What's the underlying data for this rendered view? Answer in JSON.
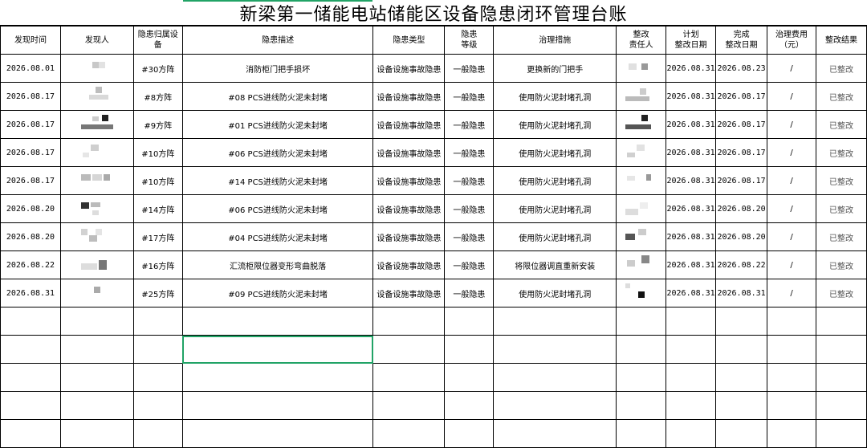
{
  "title": "新梁第一储能电站储能区设备隐患闭环管理台账",
  "columns": [
    "发现时间",
    "发现人",
    "隐患归属设备",
    "隐患描述",
    "隐患类型",
    "隐患等级",
    "治理措施",
    "整改责任人",
    "计划整改日期",
    "完成整改日期",
    "治理费用（元）",
    "整改结果"
  ],
  "header_text": {
    "c0": "发现时间",
    "c1": "发现人",
    "c2": "隐患归属设\n备",
    "c3": "隐患描述",
    "c4": "隐患类型",
    "c5": "隐患\n等级",
    "c6": "治理措施",
    "c7": "整改\n责任人",
    "c8": "计划\n整改日期",
    "c9": "完成\n整改日期",
    "c10": "治理费用\n（元）",
    "c11": "整改结果"
  },
  "rows": [
    {
      "date": "2026.08.01",
      "equipment": "#30方阵",
      "description": "消防柜门把手损坏",
      "type": "设备设施事故隐患",
      "level": "一般隐患",
      "measure": "更换新的门把手",
      "planned": "2026.08.31",
      "completed": "2026.08.23",
      "cost": "/",
      "result": "已整改"
    },
    {
      "date": "2026.08.17",
      "equipment": "#8方阵",
      "description": "#08 PCS进线防火泥未封堵",
      "type": "设备设施事故隐患",
      "level": "一般隐患",
      "measure": "使用防火泥封堵孔洞",
      "planned": "2026.08.31",
      "completed": "2026.08.17",
      "cost": "/",
      "result": "已整改"
    },
    {
      "date": "2026.08.17",
      "equipment": "#9方阵",
      "description": "#01 PCS进线防火泥未封堵",
      "type": "设备设施事故隐患",
      "level": "一般隐患",
      "measure": "使用防火泥封堵孔洞",
      "planned": "2026.08.31",
      "completed": "2026.08.17",
      "cost": "/",
      "result": "已整改"
    },
    {
      "date": "2026.08.17",
      "equipment": "#10方阵",
      "description": "#06 PCS进线防火泥未封堵",
      "type": "设备设施事故隐患",
      "level": "一般隐患",
      "measure": "使用防火泥封堵孔洞",
      "planned": "2026.08.31",
      "completed": "2026.08.17",
      "cost": "/",
      "result": "已整改"
    },
    {
      "date": "2026.08.17",
      "equipment": "#10方阵",
      "description": "#14 PCS进线防火泥未封堵",
      "type": "设备设施事故隐患",
      "level": "一般隐患",
      "measure": "使用防火泥封堵孔洞",
      "planned": "2026.08.31",
      "completed": "2026.08.17",
      "cost": "/",
      "result": "已整改"
    },
    {
      "date": "2026.08.20",
      "equipment": "#14方阵",
      "description": "#06 PCS进线防火泥未封堵",
      "type": "设备设施事故隐患",
      "level": "一般隐患",
      "measure": "使用防火泥封堵孔洞",
      "planned": "2026.08.31",
      "completed": "2026.08.20",
      "cost": "/",
      "result": "已整改"
    },
    {
      "date": "2026.08.20",
      "equipment": "#17方阵",
      "description": "#04 PCS进线防火泥未封堵",
      "type": "设备设施事故隐患",
      "level": "一般隐患",
      "measure": "使用防火泥封堵孔洞",
      "planned": "2026.08.31",
      "completed": "2026.08.20",
      "cost": "/",
      "result": "已整改"
    },
    {
      "date": "2026.08.22",
      "equipment": "#16方阵",
      "description": "汇流柜限位器变形弯曲脱落",
      "type": "设备设施事故隐患",
      "level": "一般隐患",
      "measure": "将限位器调直重新安装",
      "planned": "2026.08.31",
      "completed": "2026.08.22",
      "cost": "/",
      "result": "已整改"
    },
    {
      "date": "2026.08.31",
      "equipment": "#25方阵",
      "description": "#09 PCS进线防火泥未封堵",
      "type": "设备设施事故隐患",
      "level": "一般隐患",
      "measure": "使用防火泥封堵孔洞",
      "planned": "2026.08.31",
      "completed": "2026.08.31",
      "cost": "/",
      "result": "已整改"
    }
  ],
  "empty_rows": 5,
  "colors": {
    "selection": "#21a366",
    "grid": "#000000",
    "result_text": "#555555"
  }
}
